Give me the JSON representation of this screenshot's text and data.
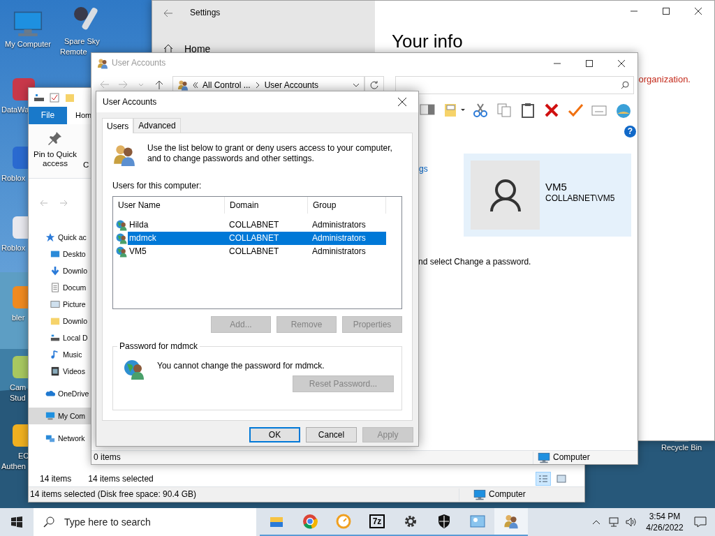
{
  "desktop": {
    "icons": [
      {
        "kind": "computer",
        "lines": [
          "My Computer"
        ]
      },
      {
        "kind": "remote",
        "lines": [
          "Spare Sky",
          "Remote"
        ]
      },
      {
        "kind": "app",
        "lines": [
          "DataWa"
        ]
      },
      {
        "kind": "app",
        "lines": [
          "Roblox"
        ]
      },
      {
        "kind": "app",
        "lines": [
          "Roblox"
        ]
      },
      {
        "kind": "app",
        "lines": [
          "bler"
        ]
      },
      {
        "kind": "app",
        "lines": [
          "Cam",
          "Stud"
        ]
      },
      {
        "kind": "app",
        "lines": [
          "EC",
          "Authen"
        ]
      },
      {
        "kind": "recycle",
        "lines": [
          "Recycle Bin"
        ]
      }
    ]
  },
  "settings": {
    "title": "Settings",
    "nav": [
      {
        "label": "Home"
      }
    ],
    "heading": "Your info",
    "notice": "organization."
  },
  "explorer": {
    "ribbon_tabs": [
      {
        "label": "File",
        "selected": true
      },
      {
        "label": "Hom",
        "selected": false
      }
    ],
    "ribbon_commands": [
      {
        "label": "Pin to Quick access"
      },
      {
        "label": "C"
      }
    ],
    "nav": [
      {
        "label": "Quick ac",
        "kind": "star",
        "selected": false
      },
      {
        "label": "Deskto",
        "kind": "desktop",
        "selected": false
      },
      {
        "label": "Downlo",
        "kind": "download",
        "selected": false
      },
      {
        "label": "Docum",
        "kind": "document",
        "selected": false
      },
      {
        "label": "Picture",
        "kind": "picture",
        "selected": false
      },
      {
        "label": "Downlo",
        "kind": "folder",
        "selected": false
      },
      {
        "label": "Local D",
        "kind": "drive",
        "selected": false
      },
      {
        "label": "Music",
        "kind": "music",
        "selected": false
      },
      {
        "label": "Videos",
        "kind": "video",
        "selected": false
      },
      {
        "label": "OneDrive",
        "kind": "cloud",
        "selected": false
      },
      {
        "label": "My Com",
        "kind": "computer",
        "selected": true
      },
      {
        "label": "Network",
        "kind": "network",
        "selected": false
      }
    ],
    "status": [
      "14 items",
      "14 items selected"
    ],
    "views": [
      {
        "kind": "details",
        "selected": true
      },
      {
        "kind": "preview",
        "selected": false
      }
    ],
    "details": "14 items selected (Disk free space: 90.4 GB)",
    "location": "Computer"
  },
  "control_panel": {
    "title": "User Accounts",
    "breadcrumb": [
      "All Control ...",
      "User Accounts"
    ],
    "toolbar": [
      {
        "kind": "layout"
      },
      {
        "kind": "properties"
      },
      {
        "kind": "cut"
      },
      {
        "kind": "copy"
      },
      {
        "kind": "paste"
      },
      {
        "kind": "delete"
      },
      {
        "kind": "check"
      },
      {
        "kind": "card"
      },
      {
        "kind": "globe"
      }
    ],
    "help_glyph": "?",
    "link": "gs",
    "profile": {
      "name": "VM5",
      "account": "COLLABNET\\VM5"
    },
    "hint": "nd select Change a password.",
    "status": "0 items",
    "location": "Computer"
  },
  "dialog": {
    "title": "User Accounts",
    "tabs": [
      {
        "label": "Users",
        "selected": true
      },
      {
        "label": "Advanced",
        "selected": false
      }
    ],
    "intro": "Use the list below to grant or deny users access to your computer, and to change passwords and other settings.",
    "list_label": "Users for this computer:",
    "columns": [
      "User Name",
      "Domain",
      "Group"
    ],
    "rows": [
      {
        "cells": [
          "Hilda",
          "COLLABNET",
          "Administrators"
        ],
        "selected": false
      },
      {
        "cells": [
          "mdmck",
          "COLLABNET",
          "Administrators"
        ],
        "selected": true
      },
      {
        "cells": [
          "VM5",
          "COLLABNET",
          "Administrators"
        ],
        "selected": false
      }
    ],
    "list_buttons": [
      {
        "label": "Add...",
        "disabled": true
      },
      {
        "label": "Remove",
        "disabled": true
      },
      {
        "label": "Properties",
        "disabled": true
      }
    ],
    "password_group": {
      "title": "Password for mdmck",
      "message": "You cannot change the password for mdmck.",
      "button": {
        "label": "Reset Password...",
        "disabled": true
      }
    },
    "footer_buttons": [
      {
        "label": "OK",
        "disabled": false,
        "default": true
      },
      {
        "label": "Cancel",
        "disabled": false,
        "default": false
      },
      {
        "label": "Apply",
        "disabled": true,
        "default": false
      }
    ]
  },
  "taskbar": {
    "search_placeholder": "Type here to search",
    "apps": [
      {
        "kind": "folder",
        "selected": false
      },
      {
        "kind": "browser",
        "selected": false
      },
      {
        "kind": "clock",
        "selected": false
      },
      {
        "kind": "archive",
        "glyph": "7z",
        "selected": false
      },
      {
        "kind": "gear",
        "selected": false
      },
      {
        "kind": "shield",
        "selected": false
      },
      {
        "kind": "panel",
        "selected": false
      },
      {
        "kind": "users",
        "selected": true
      }
    ],
    "time": "3:54 PM",
    "date": "4/26/2022"
  }
}
